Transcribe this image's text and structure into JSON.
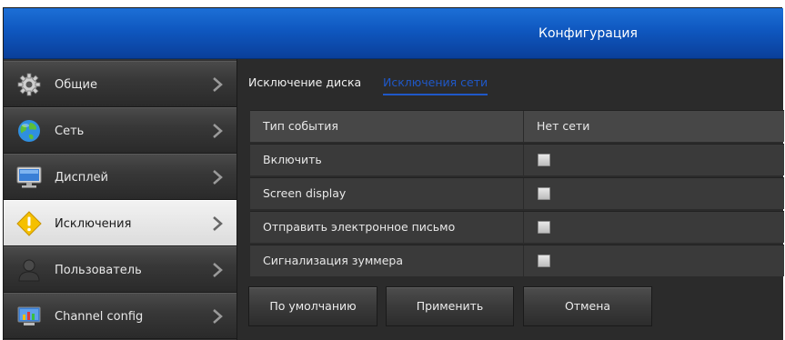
{
  "header": {
    "title": "Конфигурация"
  },
  "sidebar": {
    "items": [
      {
        "label": "Общие",
        "icon": "gear-icon",
        "active": false
      },
      {
        "label": "Сеть",
        "icon": "globe-icon",
        "active": false
      },
      {
        "label": "Дисплей",
        "icon": "monitor-icon",
        "active": false
      },
      {
        "label": "Исключения",
        "icon": "warning-icon",
        "active": true
      },
      {
        "label": "Пользователь",
        "icon": "user-icon",
        "active": false
      },
      {
        "label": "Channel config",
        "icon": "channel-config-icon",
        "active": false
      }
    ]
  },
  "tabs": [
    {
      "label": "Исключение диска",
      "active": false
    },
    {
      "label": "Исключения сети",
      "active": true
    }
  ],
  "table": {
    "header": {
      "label": "Тип события",
      "value": "Нет сети"
    },
    "rows": [
      {
        "label": "Включить",
        "checked": false
      },
      {
        "label": "Screen display",
        "checked": false
      },
      {
        "label": "Отправить электронное письмо",
        "checked": false
      },
      {
        "label": "Сигнализация зуммера",
        "checked": false
      }
    ]
  },
  "buttons": {
    "default": "По умолчанию",
    "apply": "Применить",
    "cancel": "Отмена"
  },
  "colors": {
    "title_bar": "#1565d0",
    "active_tab": "#1f58c8",
    "active_sidebar": "#e6e6e6"
  }
}
